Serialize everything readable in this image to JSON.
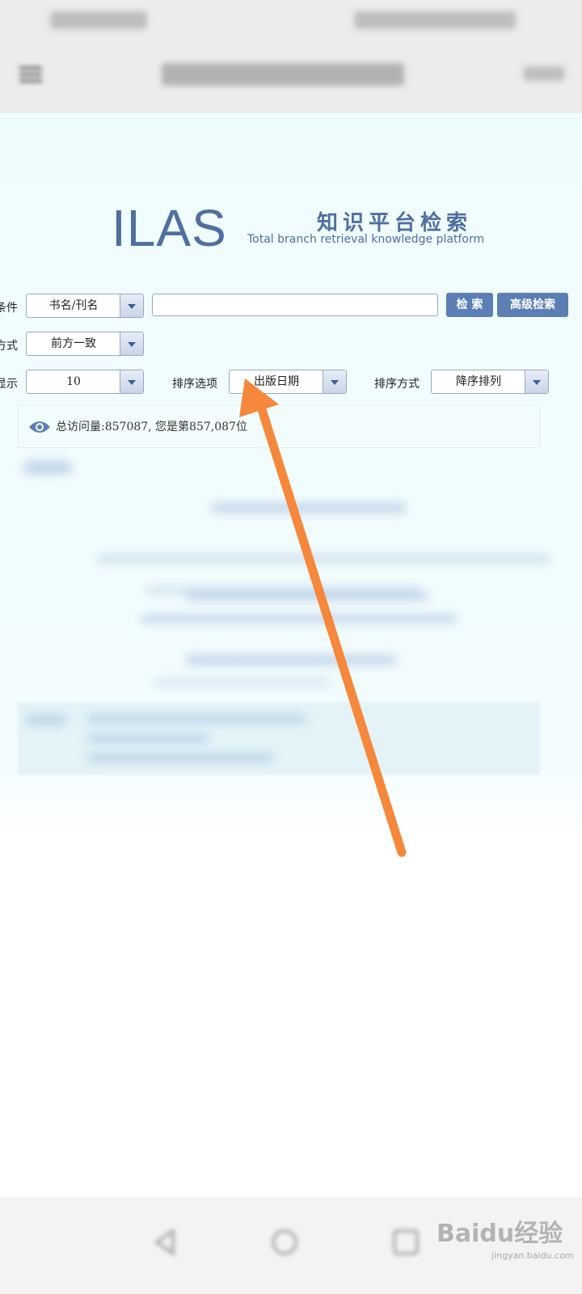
{
  "status_bar": {},
  "app_bar": {},
  "header": {
    "logo": "ILAS",
    "title_cn": "知识平台检索",
    "title_en": "Total branch retrieval knowledge platform"
  },
  "search": {
    "condition_label": "条件",
    "condition_value": "书名/刊名",
    "query_value": "",
    "search_button": "检 索",
    "advanced_button": "高级检索",
    "match_label": "方式",
    "match_value": "前方一致",
    "display_label": "显示",
    "display_value": "10",
    "sort_option_label": "排序选项",
    "sort_option_value": "出版日期",
    "sort_order_label": "排序方式",
    "sort_order_value": "降序排列"
  },
  "visit_counter": {
    "text": "总访问量:857087, 您是第857,087位"
  },
  "watermark": {
    "brand": "Baidu经验",
    "url": "jingyan.baidu.com"
  },
  "colors": {
    "accent": "#4f6fa0",
    "button": "#5b7fb5",
    "arrow": "#f5883a"
  }
}
